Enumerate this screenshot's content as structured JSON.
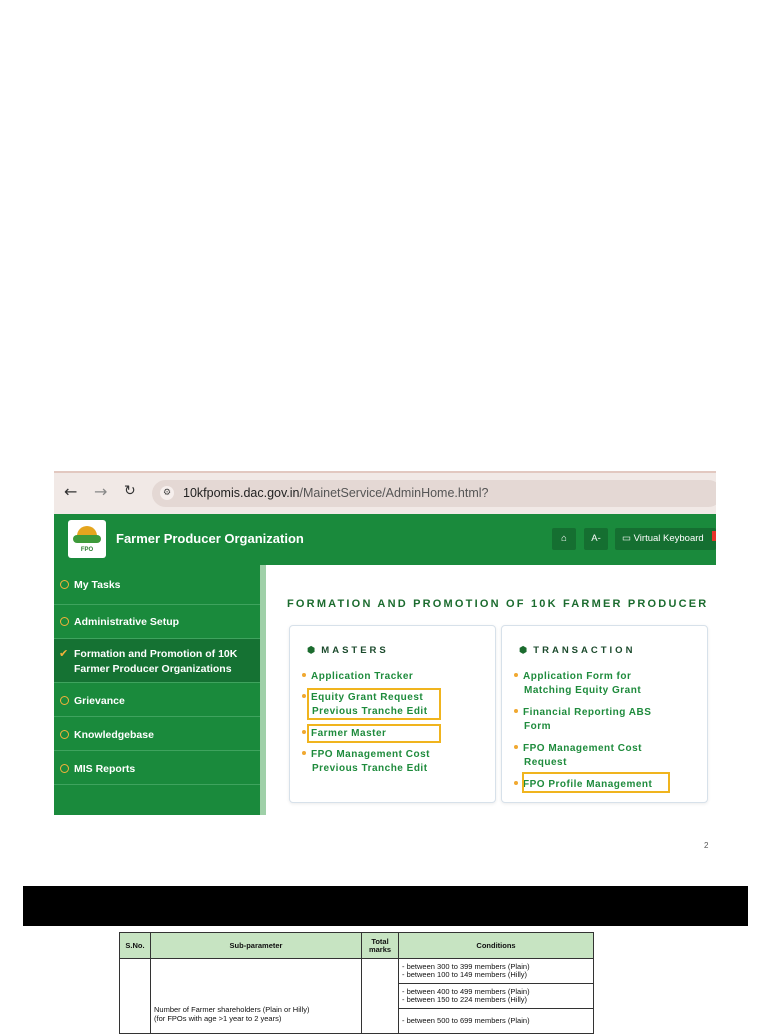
{
  "browser": {
    "back_icon": "arrow-left-icon",
    "forward_icon": "arrow-right-icon",
    "reload_icon": "reload-icon",
    "url_host": "10kfpomis.dac.gov.in",
    "url_path": "/MainetService/AdminHome.html?"
  },
  "header": {
    "logo_text": "FPO",
    "title": "Farmer Producer Organization",
    "font_button": "A-",
    "vk_label": "Virtual Keyboard",
    "brand_color": "#1a8a3c"
  },
  "sidebar": {
    "items": [
      {
        "label": "My Tasks"
      },
      {
        "label": "Administrative Setup"
      },
      {
        "label": "Formation and Promotion of 10K Farmer Producer Organizations",
        "line1": "Formation and Promotion of 10K",
        "line2": "Farmer Producer Organizations"
      },
      {
        "label": "Grievance"
      },
      {
        "label": "Knowledgebase"
      },
      {
        "label": "MIS Reports"
      }
    ]
  },
  "main": {
    "section_title": "FORMATION AND PROMOTION OF 10K FARMER PRODUCER",
    "masters": {
      "heading": "MASTERS",
      "links": [
        {
          "line1": "Application Tracker"
        },
        {
          "line1": "Equity Grant Request",
          "line2": "Previous Tranche Edit"
        },
        {
          "line1": "Farmer Master"
        },
        {
          "line1": "FPO Management Cost",
          "line2": "Previous Tranche Edit"
        }
      ]
    },
    "transaction": {
      "heading": "TRANSACTION",
      "links": [
        {
          "line1": "Application Form for",
          "line2": "Matching Equity Grant"
        },
        {
          "line1": "Financial Reporting ABS",
          "line2": "Form"
        },
        {
          "line1": "FPO Management Cost",
          "line2": "Request"
        },
        {
          "line1": "FPO Profile Management"
        }
      ]
    }
  },
  "page_number": "2",
  "table": {
    "headers": [
      "S.No.",
      "Sub-parameter",
      "Total marks",
      "Conditions"
    ],
    "sub_parameter_line1": "Number of Farmer shareholders (Plain or Hilly)",
    "sub_parameter_line2": "(for FPOs with age >1 year to 2 years)",
    "conditions": [
      {
        "line1": "- between 300 to 399 members (Plain)",
        "line2": "- between 100 to 149 members (Hilly)"
      },
      {
        "line1": "- between 400 to 499 members  (Plain)",
        "line2": "- between 150 to 224 members (Hilly)"
      },
      {
        "line1": "- between 500 to 699 members (Plain)",
        "line2": ""
      }
    ]
  }
}
